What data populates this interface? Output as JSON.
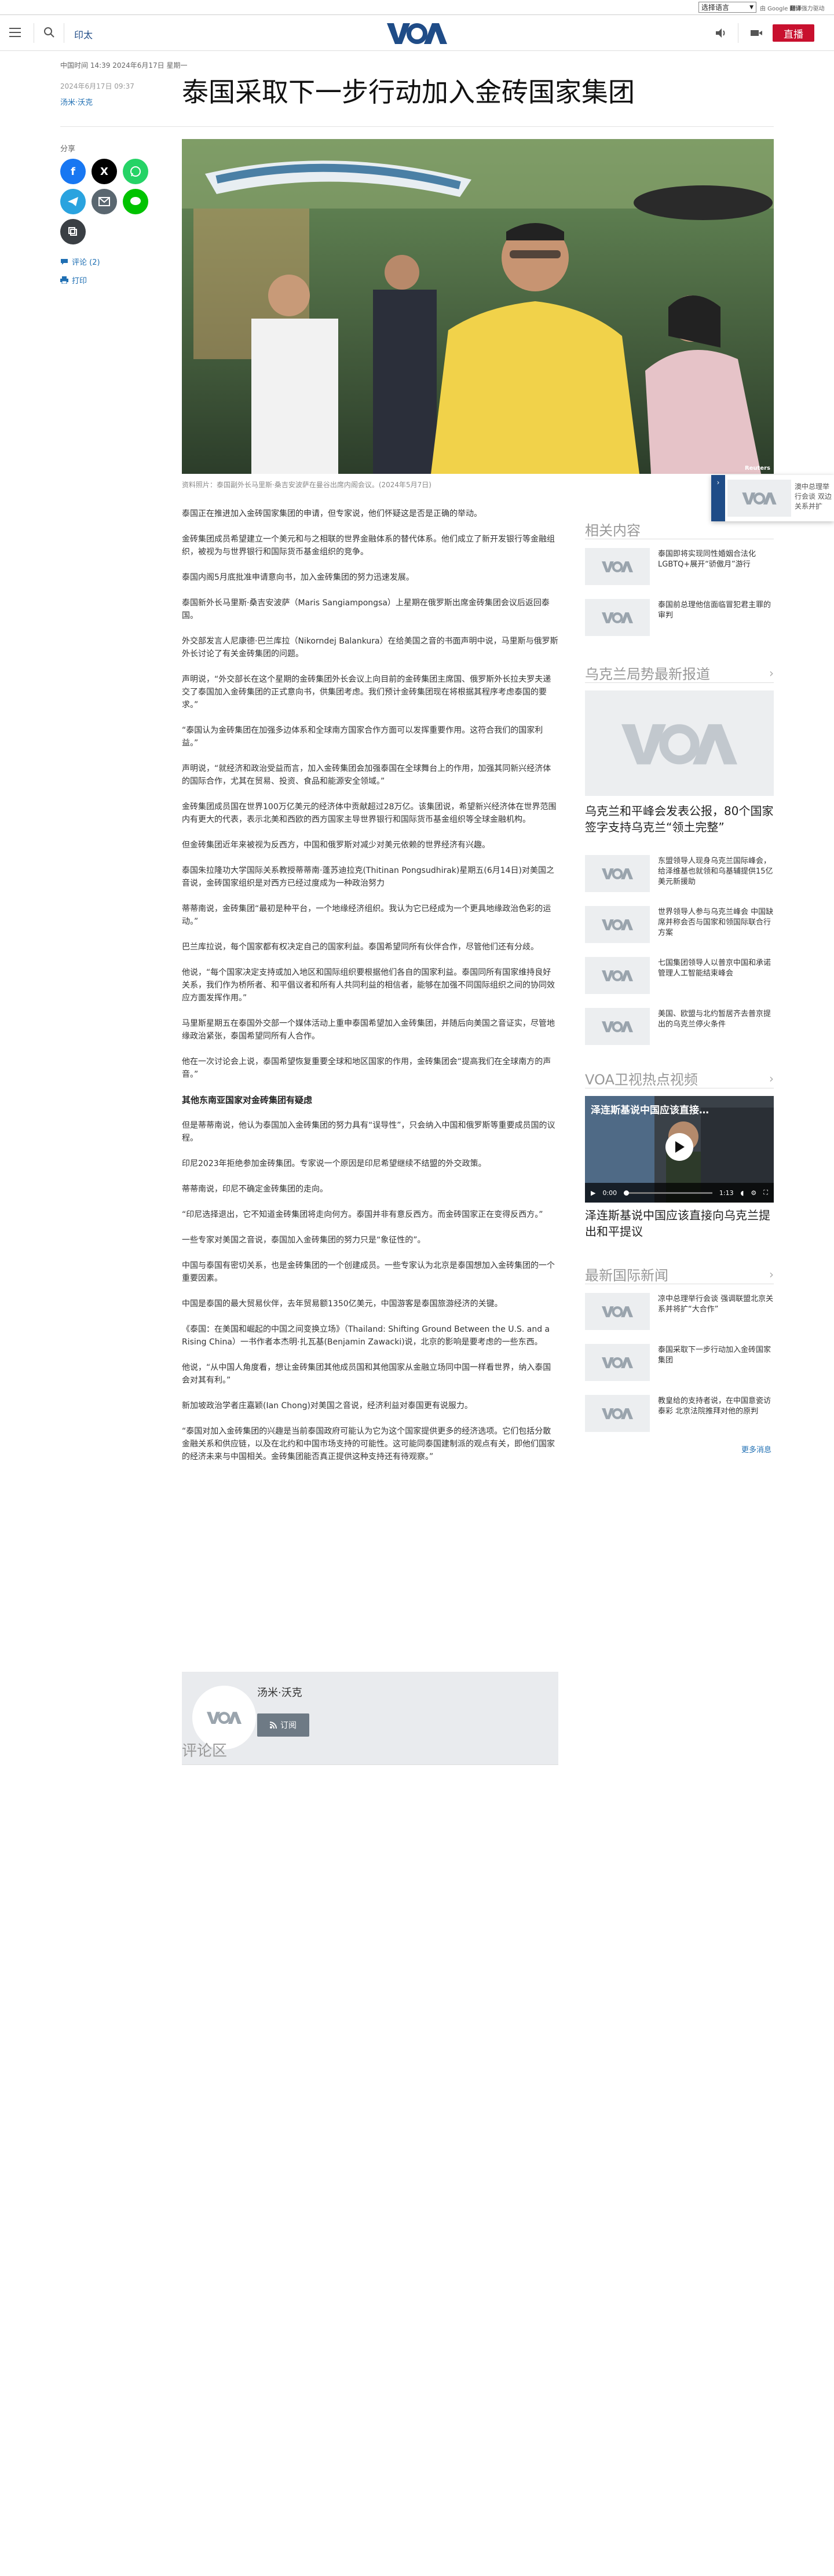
{
  "util": {
    "language_select": "选择语言",
    "translate_credit_prefix": "由 Google ",
    "translate_credit_brand": "翻译",
    "translate_credit_suffix": "强力驱动"
  },
  "header": {
    "section": "印太",
    "live": "直播"
  },
  "dateline": "中国时间 14:39 2024年6月17日 星期一",
  "article": {
    "pub_date": "2024年6月17日 09:37",
    "author": "汤米·沃克",
    "headline": "泰国采取下一步行动加入金砖国家集团",
    "caption": "资料照片：泰国副外长马里斯·桑吉安波萨在曼谷出席内阁会议。(2024年5月7日)",
    "photo_credit": "Reuters",
    "paragraphs": [
      "泰国正在推进加入金砖国家集团的申请，但专家说，他们怀疑这是否是正确的举动。",
      "金砖集团成员希望建立一个美元和与之相联的世界金融体系的替代体系。他们成立了新开发银行等金融组织，被视为与世界银行和国际货币基金组织的竞争。",
      "泰国内阁5月底批准申请意向书，加入金砖集团的努力迅速发展。",
      "泰国新外长马里斯·桑吉安波萨（Maris Sangiampongsa）上星期在俄罗斯出席金砖集团会议后返回泰国。",
      "外交部发言人尼康德·巴兰库拉（Nikorndej Balankura）在给美国之音的书面声明中说，马里斯与俄罗斯外长讨论了有关金砖集团的问题。",
      "声明说，“外交部长在这个星期的金砖集团外长会议上向目前的金砖集团主席国、俄罗斯外长拉夫罗夫递交了泰国加入金砖集团的正式意向书，供集团考虑。我们预计金砖集团现在将根据其程序考虑泰国的要求。”",
      "“泰国认为金砖集团在加强多边体系和全球南方国家合作方面可以发挥重要作用。这符合我们的国家利益。”",
      "声明说，“就经济和政治受益而言，加入金砖集团会加强泰国在全球舞台上的作用，加强其同新兴经济体的国际合作，尤其在贸易、投资、食品和能源安全领域。”",
      "金砖集团成员国在世界100万亿美元的经济体中贡献超过28万亿。该集团说，希望新兴经济体在世界范围内有更大的代表，表示北美和西欧的西方国家主导世界银行和国际货币基金组织等全球金融机构。",
      "但金砖集团近年来被视为反西方，中国和俄罗斯对减少对美元依赖的世界经济有兴趣。",
      "泰国朱拉隆功大学国际关系教授蒂蒂南·蓬苏迪拉克(Thitinan Pongsudhirak)星期五(6月14日)对美国之音说，金砖国家组织是对西方已经过度成为一种政治努力",
      "蒂蒂南说，金砖集团“最初是种平台，一个地缘经济组织。我认为它已经成为一个更具地缘政治色彩的运动。”",
      "巴兰库拉说，每个国家都有权决定自己的国家利益。泰国希望同所有伙伴合作，尽管他们还有分歧。",
      "他说，“每个国家决定支持或加入地区和国际组织要根据他们各自的国家利益。泰国同所有国家维持良好关系，我们作为桥所者、和平倡议者和所有人共同利益的相信者，能够在加强不同国际组织之间的协同效应方面发挥作用。”",
      "马里斯星期五在泰国外交部一个媒体活动上重申泰国希望加入金砖集团，并随后向美国之音证实，尽管地缘政治紧张，泰国希望同所有人合作。",
      "他在一次讨论会上说，泰国希望恢复重要全球和地区国家的作用，金砖集团会“提高我们在全球南方的声音。”",
      "但是蒂蒂南说，他认为泰国加入金砖集团的努力具有“误导性”，只会纳入中国和俄罗斯等重要成员国的议程。",
      "印尼2023年拒绝参加金砖集团。专家说一个原因是印尼希望继续不结盟的外交政策。",
      "蒂蒂南说，印尼不确定金砖集团的走向。",
      "“印尼选择退出，它不知道金砖集团将走向何方。泰国并非有意反西方。而金砖国家正在变得反西方。”",
      "一些专家对美国之音说，泰国加入金砖集团的努力只是“象征性的”。",
      "中国与泰国有密切关系，也是金砖集团的一个创建成员。一些专家认为北京是泰国想加入金砖集团的一个重要因素。",
      "中国是泰国的最大贸易伙伴，去年贸易额1350亿美元，中国游客是泰国旅游经济的关键。",
      "《泰国：在美国和崛起的中国之间变换立场》（Thailand: Shifting Ground Between the U.S. and a Rising China）一书作者本杰明·扎瓦基(Benjamin Zawacki)说，北京的影响是要考虑的一些东西。",
      "他说，“从中国人角度看，想让金砖集团其他成员国和其他国家从金融立场同中国一样看世界，纳入泰国会对其有利。”",
      "新加坡政治学者庄嘉颖(Ian Chong)对美国之音说，经济利益对泰国更有说服力。",
      "“泰国对加入金砖集团的兴趣是当前泰国政府可能认为它为这个国家提供更多的经济选项。它们包括分散金融关系和供应链，以及在北约和中国市场支持的可能性。这可能同泰国建制派的观点有关，即他们国家的经济未来与中国相关。金砖集团能否真正提供这种支持还有待观察。”"
    ],
    "subhead": "其他东南亚国家对金砖集团有疑虑",
    "subhead_after_index": 16
  },
  "share": {
    "label": "分享",
    "comments_link": "评论 (2)",
    "print_link": "打印"
  },
  "author_box": {
    "name": "汤米·沃克",
    "subscribe": "订阅"
  },
  "comments": {
    "title": "评论区"
  },
  "sidebar": {
    "related_title": "相关内容",
    "related": [
      "泰国即将实现同性婚姻合法化 LGBTQ+展开“骄傲月”游行",
      "泰国前总理他信面临冒犯君主罪的审判"
    ],
    "ukraine_title": "乌克兰局势最新报道",
    "ukraine_big": "乌克兰和平峰会发表公报，80个国家签字支持乌克兰“领土完整”",
    "ukraine": [
      "东盟领导人现身乌克兰国际峰会，给泽维基也就领和乌基辅提供15亿美元新援助",
      "世界领导人参与乌克兰峰会 中国缺席并称会否与国家和领国际联合行方案",
      "七国集团领导人以普京中国和承诺管理人工智能结束峰会",
      "美国、欧盟与北约暂居齐去普京提出的乌克兰停火条件"
    ],
    "video_title": "VOA卫视热点视频",
    "video_overlay": "泽连斯基说中国应该直接…",
    "video_time_current": "0:00",
    "video_time_total": "1:13",
    "video_caption": "泽连斯基说中国应该直接向乌克兰提出和平提议",
    "intl_title": "最新国际新闻",
    "intl": [
      "凉中总理举行会谈 强调联盟北京关系并将扩“大合作”",
      "泰国采取下一步行动加入金砖国家集团",
      "教皇给的支持者说，在中国意瓷访泰彩 北京法院推拜对他的原判"
    ],
    "more": "更多消息"
  },
  "floating": {
    "text": "澳中总理举行会谈 双边关系并扩"
  },
  "colors": {
    "brand_blue": "#1f4c87",
    "live_red": "#c8102e",
    "link_blue": "#1f6fb3"
  }
}
